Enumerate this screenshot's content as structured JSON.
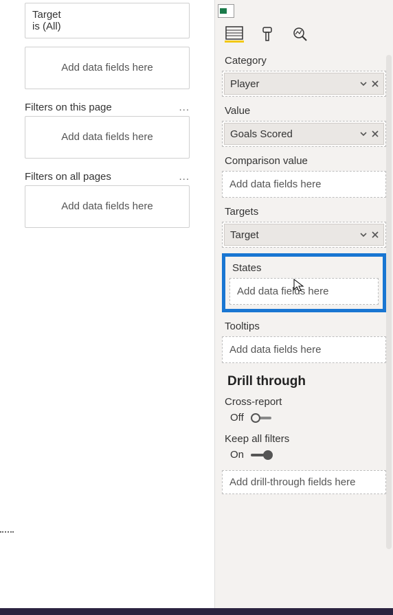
{
  "filters": {
    "visual_card_line1": "Target",
    "visual_card_line2": "is (All)",
    "add_placeholder": "Add data fields here",
    "page_header": "Filters on this page",
    "allpages_header": "Filters on all pages",
    "ellipsis": "..."
  },
  "panel": {
    "tabs": [
      "fields",
      "format",
      "analytics"
    ],
    "wells": {
      "category": {
        "label": "Category",
        "chip": "Player"
      },
      "value": {
        "label": "Value",
        "chip": "Goals Scored"
      },
      "comparison": {
        "label": "Comparison value",
        "placeholder": "Add data fields here"
      },
      "targets": {
        "label": "Targets",
        "chip": "Target"
      },
      "states": {
        "label": "States",
        "placeholder": "Add data fields here"
      },
      "tooltips": {
        "label": "Tooltips",
        "placeholder": "Add data fields here"
      }
    },
    "drill": {
      "heading": "Drill through",
      "cross_report_label": "Cross-report",
      "cross_report_state": "Off",
      "keep_filters_label": "Keep all filters",
      "keep_filters_state": "On",
      "drill_placeholder": "Add drill-through fields here"
    }
  }
}
